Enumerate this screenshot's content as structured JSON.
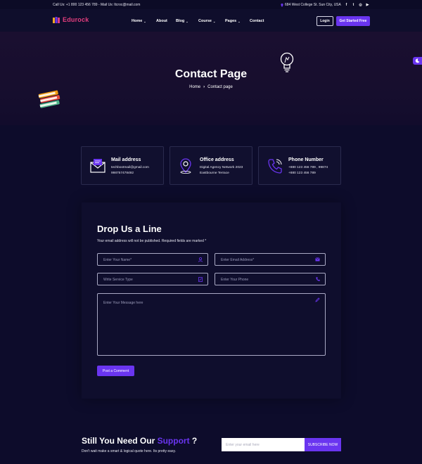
{
  "topbar": {
    "call": "Call Us: +1 800 123 456 789 - Mail Us: ltcroc@mail.com",
    "address": "684 West College St. Sun City, USA",
    "social": [
      "f",
      "t",
      "◎",
      "▶"
    ]
  },
  "header": {
    "logo": "Edurock",
    "nav": [
      {
        "label": "Home",
        "dropdown": true
      },
      {
        "label": "About",
        "dropdown": false
      },
      {
        "label": "Blog",
        "dropdown": true
      },
      {
        "label": "Course",
        "dropdown": true
      },
      {
        "label": "Pages",
        "dropdown": true
      },
      {
        "label": "Contact",
        "dropdown": false
      }
    ],
    "login": "Login",
    "get_started": "Get Started Free"
  },
  "hero": {
    "title": "Contact Page",
    "breadcrumb": {
      "home": "Home",
      "current": "Contact page"
    }
  },
  "cards": [
    {
      "title": "Mail address",
      "line1": "techbootmail@gmail.com",
      "line2": "998757478492",
      "icon": "mail-icon"
    },
    {
      "title": "Office address",
      "line1": "Digital Agency Network 2023",
      "line2": "Eastbourne Terrace",
      "icon": "location-icon"
    },
    {
      "title": "Phone Number",
      "line1": "+880 123 456 789 , 99874",
      "line2": "+880 123 456 789",
      "icon": "phone-icon"
    }
  ],
  "form": {
    "title": "Drop Us a Line",
    "note": "Your email address will not be published. Required fields are marked *",
    "name_placeholder": "Enter Your Name*",
    "email_placeholder": "Enter Email Address*",
    "service_placeholder": "Write Service Type",
    "phone_placeholder": "Enter Your Phone",
    "message_placeholder": "Enter Your Message here",
    "submit": "Post a Comment"
  },
  "newsletter": {
    "title_pre": "Still You Need Our ",
    "title_accent": "Support",
    "title_post": " ?",
    "subtitle": "Don't wait make a smart & logical quote here. Its pretty easy.",
    "placeholder": "Enter your email here",
    "button": "SUBSCRIBE NOW"
  },
  "colors": {
    "accent": "#6a35f0",
    "logo": "#e23d7d",
    "background": "#0d0c2b"
  }
}
